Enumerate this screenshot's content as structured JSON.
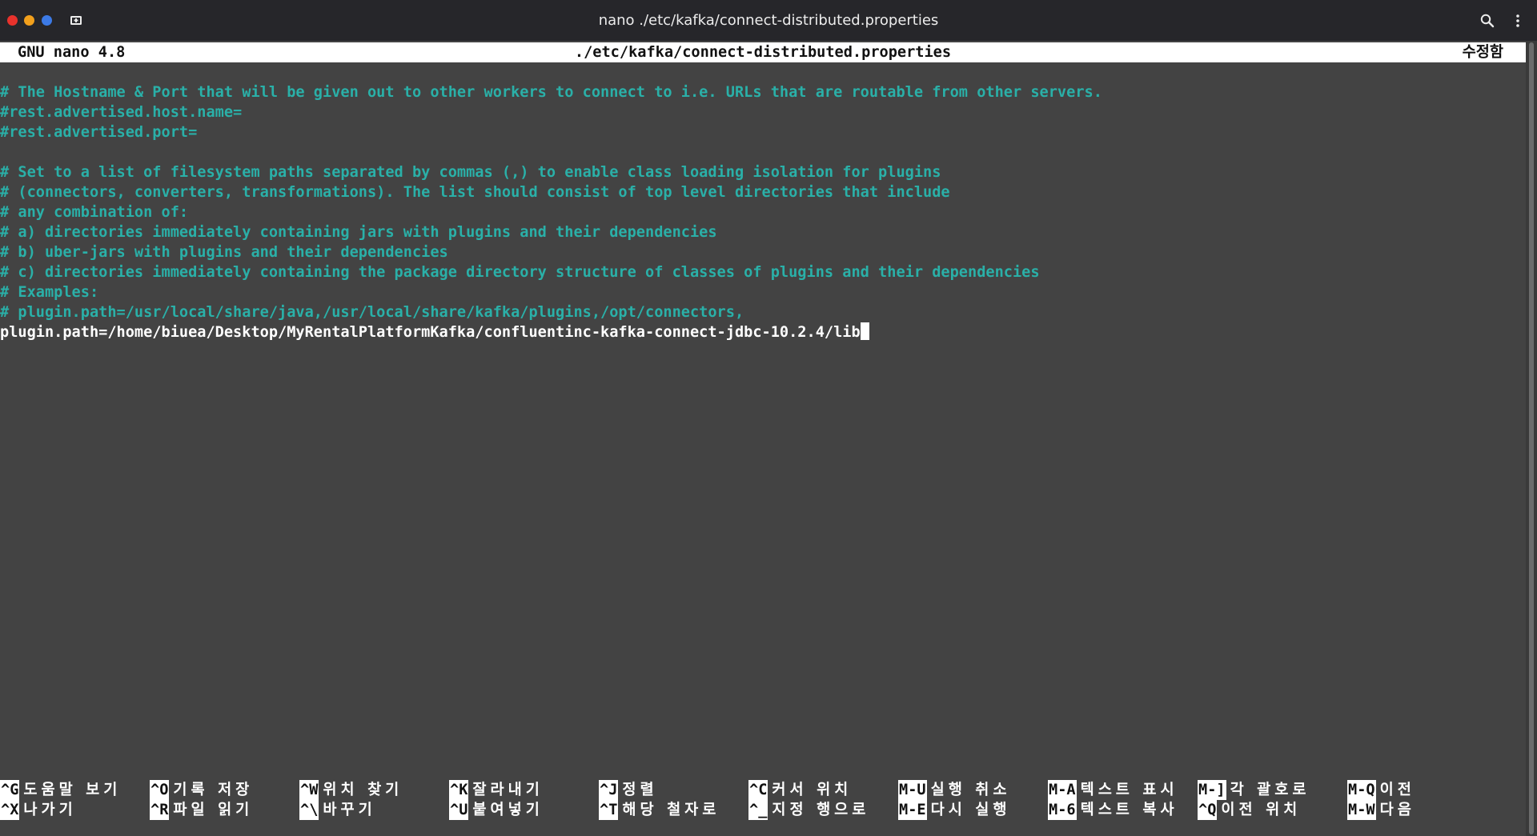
{
  "window": {
    "title": "nano ./etc/kafka/connect-distributed.properties"
  },
  "nano": {
    "version": "GNU nano 4.8",
    "filename": "./etc/kafka/connect-distributed.properties",
    "status": "수정함"
  },
  "editor": {
    "lines": [
      {
        "kind": "comment",
        "text": "# The Hostname & Port that will be given out to other workers to connect to i.e. URLs that are routable from other servers."
      },
      {
        "kind": "comment",
        "text": "#rest.advertised.host.name="
      },
      {
        "kind": "comment",
        "text": "#rest.advertised.port="
      },
      {
        "kind": "blank",
        "text": ""
      },
      {
        "kind": "comment",
        "text": "# Set to a list of filesystem paths separated by commas (,) to enable class loading isolation for plugins"
      },
      {
        "kind": "comment",
        "text": "# (connectors, converters, transformations). The list should consist of top level directories that include"
      },
      {
        "kind": "comment",
        "text": "# any combination of:"
      },
      {
        "kind": "comment",
        "text": "# a) directories immediately containing jars with plugins and their dependencies"
      },
      {
        "kind": "comment",
        "text": "# b) uber-jars with plugins and their dependencies"
      },
      {
        "kind": "comment",
        "text": "# c) directories immediately containing the package directory structure of classes of plugins and their dependencies"
      },
      {
        "kind": "comment",
        "text": "# Examples:"
      },
      {
        "kind": "comment",
        "text": "# plugin.path=/usr/local/share/java,/usr/local/share/kafka/plugins,/opt/connectors,"
      },
      {
        "kind": "code",
        "text": "plugin.path=/home/biuea/Desktop/MyRentalPlatformKafka/confluentinc-kafka-connect-jdbc-10.2.4/lib"
      }
    ]
  },
  "shortcuts": {
    "row1": [
      {
        "key": "^G",
        "label": "도움말 보기"
      },
      {
        "key": "^O",
        "label": "기록 저장"
      },
      {
        "key": "^W",
        "label": "위치 찾기"
      },
      {
        "key": "^K",
        "label": "잘라내기"
      },
      {
        "key": "^J",
        "label": "정렬"
      },
      {
        "key": "^C",
        "label": "커서 위치"
      },
      {
        "key": "M-U",
        "label": "실행 취소"
      },
      {
        "key": "M-A",
        "label": "텍스트 표시"
      },
      {
        "key": "M-]",
        "label": "각 괄호로"
      },
      {
        "key": "M-Q",
        "label": "이전"
      }
    ],
    "row2": [
      {
        "key": "^X",
        "label": "나가기"
      },
      {
        "key": "^R",
        "label": "파일 읽기"
      },
      {
        "key": "^\\",
        "label": "바꾸기"
      },
      {
        "key": "^U",
        "label": "붙여넣기"
      },
      {
        "key": "^T",
        "label": "해당 철자로"
      },
      {
        "key": "^_",
        "label": "지정 행으로"
      },
      {
        "key": "M-E",
        "label": "다시 실행"
      },
      {
        "key": "M-6",
        "label": "텍스트 복사"
      },
      {
        "key": "^Q",
        "label": "이전 위치"
      },
      {
        "key": "M-W",
        "label": "다음"
      }
    ]
  },
  "icons": {
    "close": "close-traffic-light",
    "minimize": "minimize-traffic-light",
    "maximize": "maximize-traffic-light",
    "new_tab": "new-tab-icon",
    "search": "search-icon",
    "menu": "kebab-menu-icon"
  },
  "colors": {
    "titlebar": "#26262a",
    "terminal_bg": "#434343",
    "comment": "#2ab0a8",
    "text": "#ffffff",
    "close": "#e8322c",
    "minimize": "#f2a01c",
    "maximize": "#3c7ae6"
  }
}
